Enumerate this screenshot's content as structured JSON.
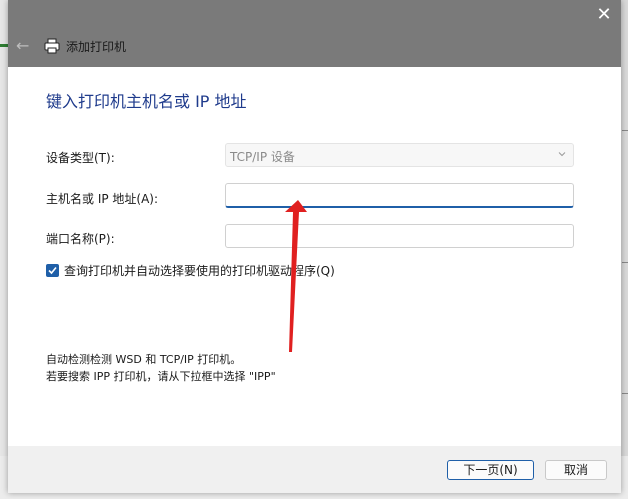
{
  "window": {
    "title": "添加打印机",
    "heading": "键入打印机主机名或 IP 地址"
  },
  "form": {
    "device_type_label": "设备类型(T):",
    "device_type_value": "TCP/IP 设备",
    "hostname_label": "主机名或 IP 地址(A):",
    "hostname_value": "",
    "port_label": "端口名称(P):",
    "port_value": "",
    "auto_select_label": "查询打印机并自动选择要使用的打印机驱动程序(Q)",
    "auto_select_checked": true
  },
  "info": {
    "line1": "自动检测检测 WSD 和 TCP/IP 打印机。",
    "line2": "若要搜索 IPP 打印机，请从下拉框中选择 \"IPP\""
  },
  "buttons": {
    "next": "下一页(N)",
    "cancel": "取消"
  },
  "icons": {
    "close": "close-icon",
    "back": "back-arrow-icon",
    "printer": "printer-icon",
    "dropdown": "chevron-down-icon",
    "check": "check-icon"
  },
  "colors": {
    "titlebar": "#7a7a7a",
    "heading": "#1f3b8c",
    "accent": "#1f5fa8",
    "annotation_arrow": "#e02020"
  }
}
